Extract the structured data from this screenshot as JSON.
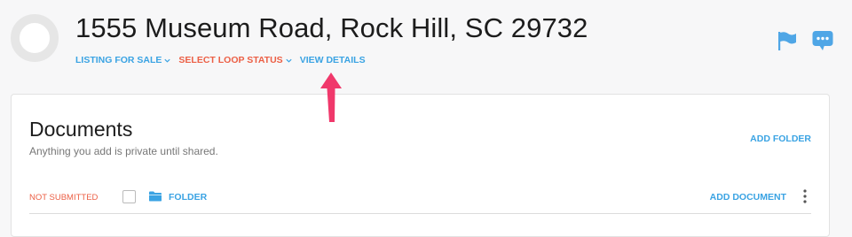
{
  "header": {
    "address": "1555 Museum Road, Rock Hill, SC 29732",
    "menu": [
      {
        "label": "LISTING FOR SALE",
        "has_caret": true,
        "color": "#3aa3e3"
      },
      {
        "label": "SELECT LOOP STATUS",
        "has_caret": true,
        "color": "#ec5f45"
      },
      {
        "label": "VIEW DETAILS",
        "has_caret": false,
        "color": "#3aa3e3"
      }
    ],
    "icons": [
      "flag-icon",
      "chat-icon"
    ]
  },
  "annotation": {
    "color": "#f0386b"
  },
  "documents": {
    "title": "Documents",
    "subtitle": "Anything you add is private until shared.",
    "add_folder_label": "ADD FOLDER",
    "row": {
      "status": "NOT SUBMITTED",
      "folder_label": "FOLDER",
      "add_document_label": "ADD DOCUMENT"
    }
  },
  "colors": {
    "accent": "#3aa3e3",
    "alert": "#ec5f45",
    "text": "#1c1c1c"
  }
}
